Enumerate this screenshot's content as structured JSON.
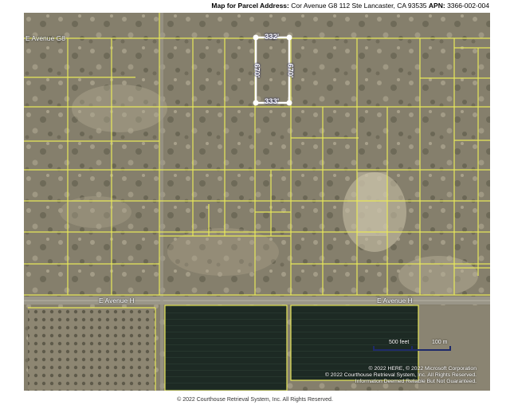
{
  "header": {
    "title_label": "Map for Parcel Address:",
    "address": "Cor Avenue G8 112 Ste Lancaster, CA 93535",
    "apn_label": "APN:",
    "apn": "3366-002-004"
  },
  "map": {
    "roads": {
      "avenue_g8": "E Avenue G8",
      "avenue_h_left": "E Avenue H",
      "avenue_h_right": "E Avenue H"
    },
    "parcel": {
      "top_dim": "332'",
      "bottom_dim": "333'",
      "left_dim": "670'",
      "right_dim": "670'",
      "outline_color": "#ffffff"
    },
    "parcel_line_color": "#e8e85a",
    "scale": {
      "feet_label": "500 feet",
      "meters_label": "100 m"
    },
    "copyright": {
      "line1": "© 2022 HERE, © 2022 Microsoft Corporation",
      "line2": "© 2022 Courthouse Retrieval System, Inc. All Rights Reserved.",
      "line3": "Information Deemed Reliable But Not Guaranteed."
    }
  },
  "footer": {
    "text": "© 2022 Courthouse Retrieval System, Inc. All Rights Reserved."
  }
}
